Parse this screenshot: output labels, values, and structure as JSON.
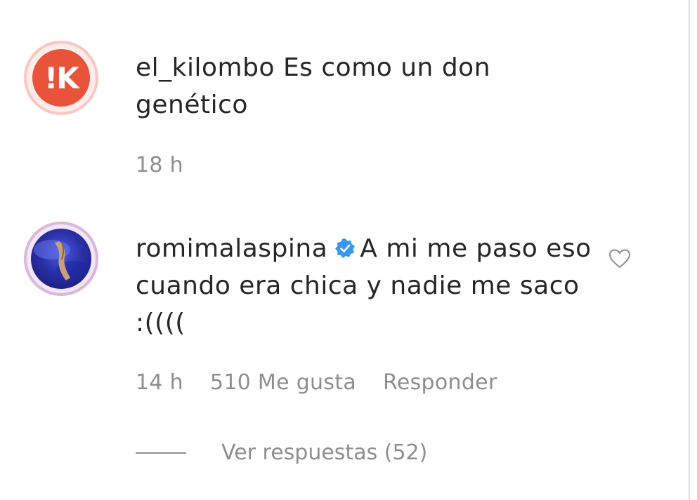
{
  "comments": [
    {
      "username": "el_kilombo",
      "text": "Es como un don genético",
      "time": "18 h",
      "avatar_letter": "!K",
      "avatar_color": "#e8533a"
    },
    {
      "username": "romimalaspina",
      "verified": true,
      "text": "A mi me paso eso cuando era chica y nadie me saco :((((",
      "time": "14 h",
      "likes": "510 Me gusta",
      "reply_label": "Responder",
      "view_replies": "Ver respuestas (52)"
    }
  ],
  "colors": {
    "text": "#262626",
    "secondary": "#8e8e8e",
    "verified_blue": "#3897f0"
  }
}
